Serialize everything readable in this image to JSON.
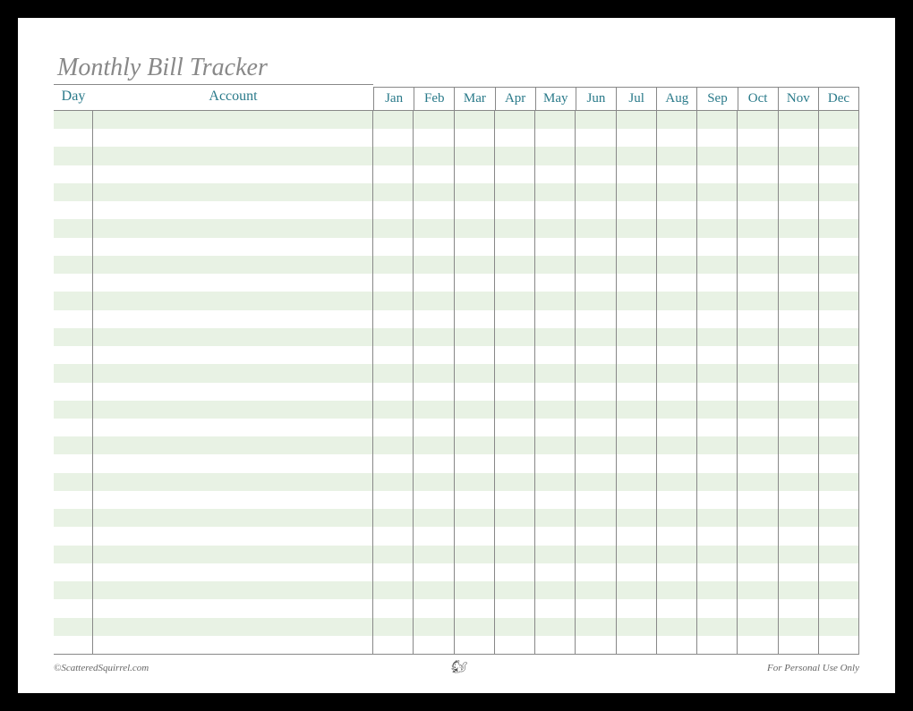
{
  "title": "Monthly Bill Tracker",
  "columns": {
    "day": "Day",
    "account": "Account",
    "months": [
      "Jan",
      "Feb",
      "Mar",
      "Apr",
      "May",
      "Jun",
      "Jul",
      "Aug",
      "Sep",
      "Oct",
      "Nov",
      "Dec"
    ]
  },
  "rows_count": 30,
  "footer": {
    "left": "©ScatteredSquirrel.com",
    "center": "🐿",
    "right": "For Personal Use Only"
  }
}
